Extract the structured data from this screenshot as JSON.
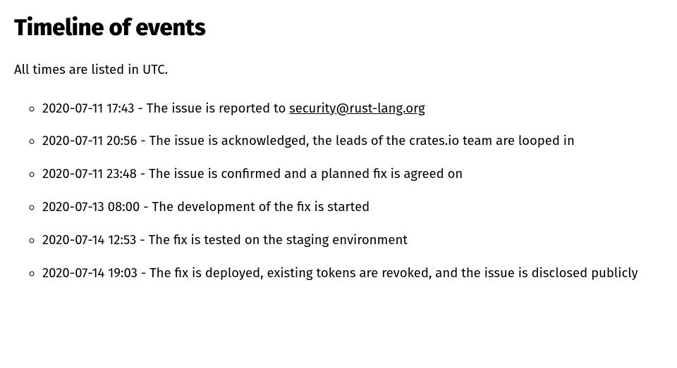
{
  "heading": "Timeline of events",
  "intro": "All times are listed in UTC.",
  "events": [
    {
      "ts": "2020-07-11 17:43",
      "sep": " - ",
      "pre": "The issue is reported to ",
      "link": "security@rust-lang.org",
      "post": ""
    },
    {
      "ts": "2020-07-11 20:56",
      "sep": " - ",
      "pre": "The issue is acknowledged, the leads of the crates.io team are looped in",
      "link": "",
      "post": ""
    },
    {
      "ts": "2020-07-11 23:48",
      "sep": " - ",
      "pre": "The issue is confirmed and a planned fix is agreed on",
      "link": "",
      "post": ""
    },
    {
      "ts": "2020-07-13 08:00",
      "sep": " - ",
      "pre": "The development of the fix is started",
      "link": "",
      "post": ""
    },
    {
      "ts": "2020-07-14 12:53",
      "sep": " - ",
      "pre": "The fix is tested on the staging environment",
      "link": "",
      "post": ""
    },
    {
      "ts": "2020-07-14 19:03",
      "sep": " - ",
      "pre": "The fix is deployed, existing tokens are revoked, and the issue is disclosed publicly",
      "link": "",
      "post": ""
    }
  ]
}
